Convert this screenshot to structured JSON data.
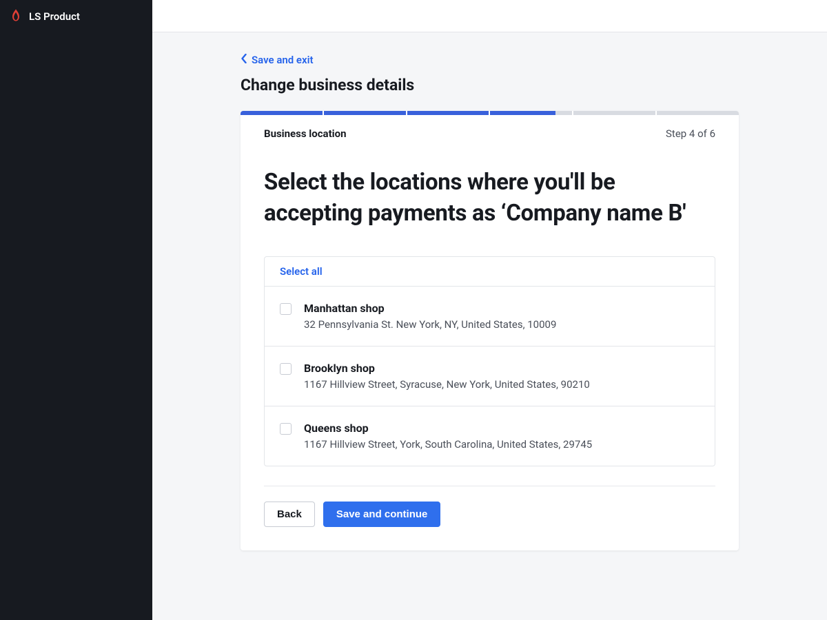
{
  "product": {
    "name": "LS Product"
  },
  "nav": {
    "save_exit": "Save and exit"
  },
  "page": {
    "title": "Change business details",
    "section_label": "Business location",
    "step_label": "Step 4 of 6",
    "heading": "Select the locations where you'll be accepting payments as ‘Company name B'"
  },
  "progress": {
    "total_segments": 6,
    "filled_segments": 3,
    "partial_segment": true
  },
  "locations": {
    "select_all_label": "Select all",
    "items": [
      {
        "name": "Manhattan shop",
        "address": "32 Pennsylvania St. New York, NY, United States, 10009",
        "checked": false
      },
      {
        "name": "Brooklyn shop",
        "address": "1167 Hillview Street, Syracuse, New York, United States, 90210",
        "checked": false
      },
      {
        "name": "Queens shop",
        "address": "1167 Hillview Street, York, South Carolina, United States, 29745",
        "checked": false
      }
    ]
  },
  "buttons": {
    "back": "Back",
    "continue": "Save and continue"
  },
  "colors": {
    "accent": "#2f6fed",
    "link": "#2563eb",
    "progress": "#3961db"
  }
}
